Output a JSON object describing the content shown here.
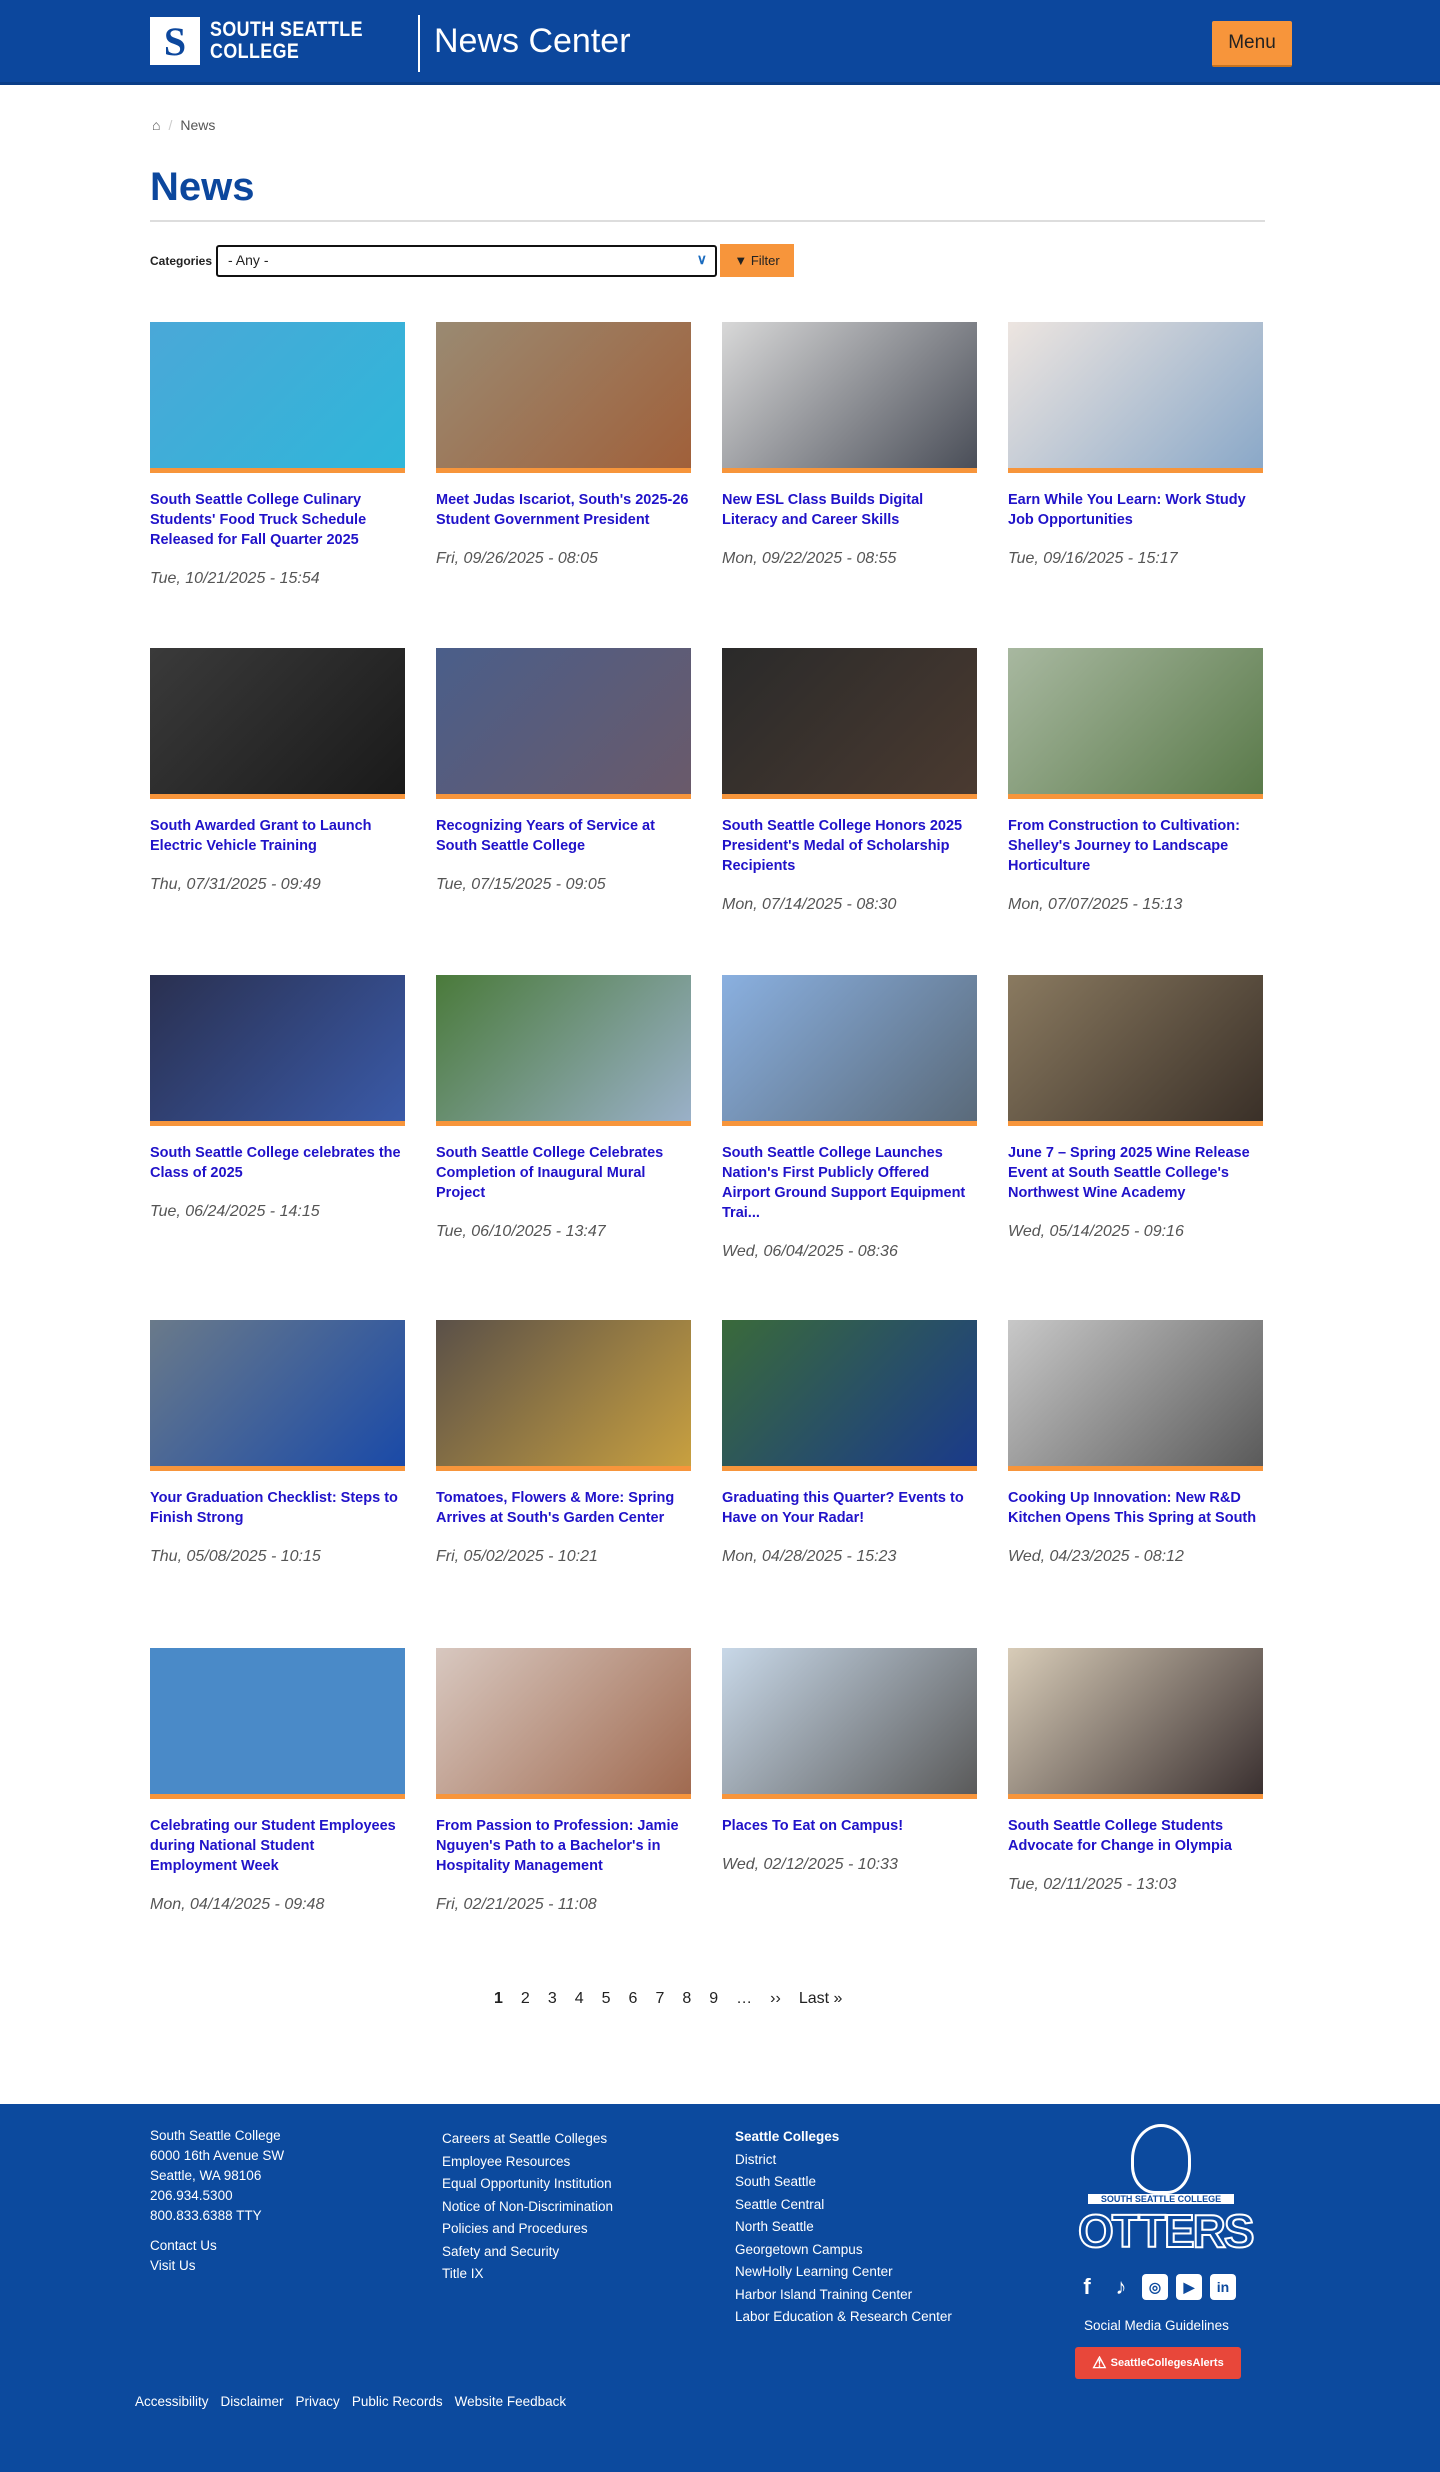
{
  "header": {
    "logo_mark": "S",
    "logo_line1": "SOUTH SEATTLE",
    "logo_line2": "COLLEGE",
    "site_name": "News Center",
    "menu_label": "Menu"
  },
  "breadcrumb": {
    "home_icon": "home-icon",
    "current": "News",
    "sep": "/"
  },
  "page_title": "News",
  "filters": {
    "label": "Categories",
    "selected": "- Any -",
    "button": "Filter"
  },
  "cards": [
    {
      "title": "South Seattle College Culinary Students' Food Truck Schedule Released for Fall Quarter 2025",
      "date": "Tue, 10/21/2025 - 15:54",
      "img": [
        "#4aa8d8",
        "#2fb6d9"
      ]
    },
    {
      "title": "Meet Judas Iscariot, South's 2025-26 Student Government President",
      "date": "Fri, 09/26/2025 - 08:05",
      "img": [
        "#9a8a72",
        "#a0603a"
      ]
    },
    {
      "title": "New ESL Class Builds Digital Literacy and Career Skills",
      "date": "Mon, 09/22/2025 - 08:55",
      "img": [
        "#d8d8d8",
        "#4a4e58"
      ]
    },
    {
      "title": "Earn While You Learn: Work Study Job Opportunities",
      "date": "Tue, 09/16/2025 - 15:17",
      "img": [
        "#ede5e0",
        "#8aa8c8"
      ]
    },
    {
      "title": "South Awarded Grant to Launch Electric Vehicle Training",
      "date": "Thu, 07/31/2025 - 09:49",
      "img": [
        "#3a3a3a",
        "#1a1a1a"
      ]
    },
    {
      "title": "Recognizing Years of Service at South Seattle College",
      "date": "Tue, 07/15/2025 - 09:05",
      "img": [
        "#4a5e8a",
        "#6a5a6a"
      ]
    },
    {
      "title": "South Seattle College Honors 2025 President's Medal of Scholarship Recipients",
      "date": "Mon, 07/14/2025 - 08:30",
      "img": [
        "#2a2a2a",
        "#4a3a30"
      ]
    },
    {
      "title": "From Construction to Cultivation: Shelley's Journey to Landscape Horticulture",
      "date": "Mon, 07/07/2025 - 15:13",
      "img": [
        "#a8b8a0",
        "#5a7a4a"
      ]
    },
    {
      "title": "South Seattle College celebrates the Class of 2025",
      "date": "Tue, 06/24/2025 - 14:15",
      "img": [
        "#2a3050",
        "#3a5aa8"
      ]
    },
    {
      "title": "South Seattle College Celebrates Completion of Inaugural Mural Project",
      "date": "Tue, 06/10/2025 - 13:47",
      "img": [
        "#4a7a3a",
        "#9ab0c8"
      ]
    },
    {
      "title": "South Seattle College Launches Nation's First Publicly Offered Airport Ground Support Equipment Trai...",
      "date": "Wed, 06/04/2025 - 08:36",
      "img": [
        "#8ab0e0",
        "#5a6a7a"
      ]
    },
    {
      "title": "June 7 – Spring 2025 Wine Release Event at South Seattle College's Northwest Wine Academy",
      "date": "Wed, 05/14/2025 - 09:16",
      "img": [
        "#8a7a60",
        "#3a3028"
      ]
    },
    {
      "title": "Your Graduation Checklist: Steps to Finish Strong",
      "date": "Thu, 05/08/2025 - 10:15",
      "img": [
        "#6a7a8a",
        "#1a4aa8"
      ]
    },
    {
      "title": "Tomatoes, Flowers & More: Spring Arrives at South's Garden Center",
      "date": "Fri, 05/02/2025 - 10:21",
      "img": [
        "#5a5048",
        "#c8a040"
      ]
    },
    {
      "title": "Graduating this Quarter? Events to Have on Your Radar!",
      "date": "Mon, 04/28/2025 - 15:23",
      "img": [
        "#3a6a3a",
        "#1a3a8a"
      ]
    },
    {
      "title": "Cooking Up Innovation: New R&D Kitchen Opens This Spring at South",
      "date": "Wed, 04/23/2025 - 08:12",
      "img": [
        "#c8c8c8",
        "#5a5a5a"
      ]
    },
    {
      "title": "Celebrating our Student Employees during National Student Employment Week",
      "date": "Mon, 04/14/2025 - 09:48",
      "img": [
        "#4a8ac8",
        "#4a8ac8"
      ]
    },
    {
      "title": "From Passion to Profession: Jamie Nguyen's Path to a Bachelor's in Hospitality Management",
      "date": "Fri, 02/21/2025 - 11:08",
      "img": [
        "#d8c8c0",
        "#a06a50"
      ]
    },
    {
      "title": "Places To Eat on Campus!",
      "date": "Wed, 02/12/2025 - 10:33",
      "img": [
        "#c8d8e8",
        "#5a5a5a"
      ]
    },
    {
      "title": "South Seattle College Students Advocate for Change in Olympia",
      "date": "Tue, 02/11/2025 - 13:03",
      "img": [
        "#d8ccb8",
        "#3a3030"
      ]
    }
  ],
  "pager": {
    "pages": [
      "1",
      "2",
      "3",
      "4",
      "5",
      "6",
      "7",
      "8",
      "9"
    ],
    "ellipsis": "…",
    "next": "››",
    "last": "Last »"
  },
  "footer": {
    "address": [
      "South Seattle College",
      "6000 16th Avenue SW",
      "Seattle, WA 98106",
      "206.934.5300",
      "800.833.6388 TTY"
    ],
    "contact": [
      "Contact Us",
      "Visit Us"
    ],
    "links": [
      "Careers at Seattle Colleges",
      "Employee Resources",
      "Equal Opportunity Institution",
      "Notice of Non-Discrimination",
      "Policies and Procedures",
      "Safety and Security",
      "Title IX"
    ],
    "colleges_heading": "Seattle Colleges",
    "colleges": [
      "District",
      "South Seattle",
      "Seattle Central",
      "North Seattle",
      "Georgetown Campus",
      "NewHolly Learning Center",
      "Harbor Island Training Center",
      "Labor Education & Research Center"
    ],
    "mascot_sub": "SOUTH SEATTLE COLLEGE",
    "mascot_word": "OTTERS",
    "social": [
      "f",
      "♪",
      "◎",
      "▶",
      "in"
    ],
    "social_guidelines": "Social Media Guidelines",
    "alerts": "SeattleCollegesAlerts",
    "legal": [
      "Accessibility",
      "Disclaimer",
      "Privacy",
      "Public Records",
      "Website Feedback"
    ]
  },
  "colors": {
    "brand_blue": "#0c479d",
    "accent_orange": "#f7953b",
    "link": "#2012c9"
  }
}
